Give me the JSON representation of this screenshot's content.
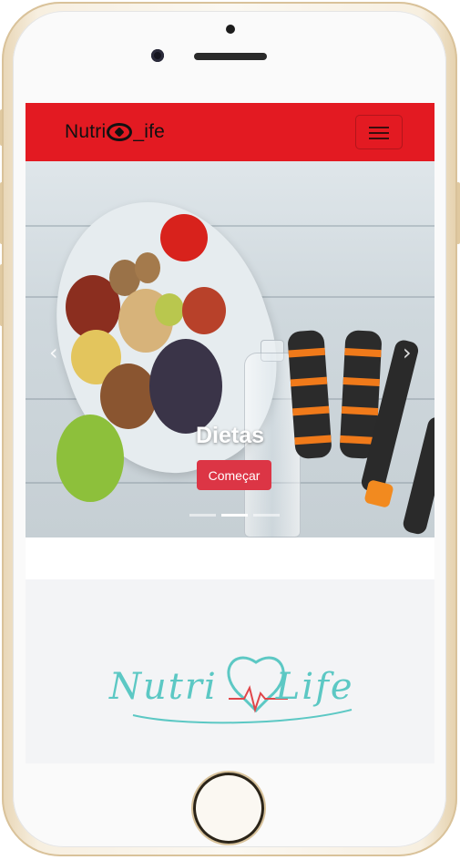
{
  "navbar": {
    "brand_prefix": "Nutri",
    "brand_suffix": "_ife",
    "background_color": "#e31a22"
  },
  "carousel": {
    "caption_title": "Dietas",
    "caption_button": "Começar",
    "button_color": "#dc3545",
    "indicator_count": 3,
    "active_indicator": 2
  },
  "footer": {
    "logo_text_left": "Nutri",
    "logo_text_right": "Life",
    "logo_color": "#5cc8c4"
  }
}
